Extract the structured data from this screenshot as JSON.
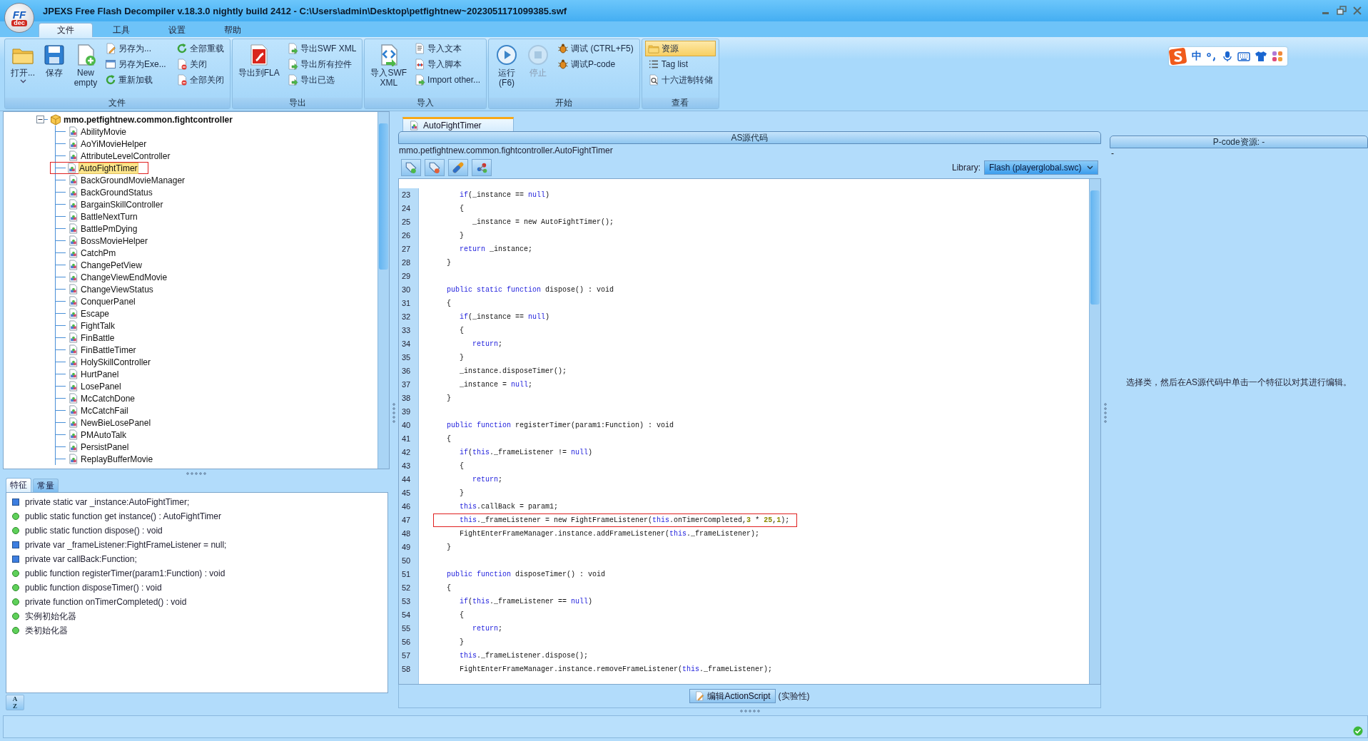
{
  "window": {
    "logo_top": "FF",
    "logo_bottom": "dec",
    "title": "JPEXS Free Flash Decompiler v.18.3.0 nightly build 2412 - C:\\Users\\admin\\Desktop\\petfightnew~2023051171099385.swf"
  },
  "menu_tabs": [
    {
      "label": "文件",
      "selected": true
    },
    {
      "label": "工具",
      "selected": false
    },
    {
      "label": "设置",
      "selected": false
    },
    {
      "label": "帮助",
      "selected": false
    }
  ],
  "ribbon": [
    {
      "title": "文件",
      "large": [
        {
          "lines": [
            "打开..."
          ],
          "dropdown": true,
          "disabled": false
        },
        {
          "lines": [
            "保存"
          ],
          "dropdown": false,
          "disabled": false
        },
        {
          "lines": [
            "New",
            "empty"
          ],
          "dropdown": false,
          "disabled": false
        }
      ],
      "small": [
        {
          "label": "另存为..."
        },
        {
          "label": "另存为Exe..."
        },
        {
          "label": "重新加载"
        },
        {
          "label": "全部重载"
        },
        {
          "label": "关闭"
        },
        {
          "label": "全部关闭"
        }
      ]
    },
    {
      "title": "导出",
      "large": [
        {
          "lines": [
            "导出到FLA"
          ],
          "dropdown": false,
          "disabled": false
        }
      ],
      "small": [
        {
          "label": "导出SWF XML"
        },
        {
          "label": "导出所有控件"
        },
        {
          "label": "导出已选"
        }
      ]
    },
    {
      "title": "导入",
      "large": [
        {
          "lines": [
            "导入SWF",
            "XML"
          ],
          "dropdown": false,
          "disabled": false
        }
      ],
      "small": [
        {
          "label": "导入文本"
        },
        {
          "label": "导入脚本"
        },
        {
          "label": "Import other..."
        }
      ]
    },
    {
      "title": "开始",
      "large": [
        {
          "lines": [
            "运行",
            "(F6)"
          ],
          "dropdown": false,
          "disabled": false
        },
        {
          "lines": [
            "停止"
          ],
          "dropdown": false,
          "disabled": true
        }
      ],
      "small": [
        {
          "label": "调试 (CTRL+F5)"
        },
        {
          "label": "调试P-code"
        }
      ]
    },
    {
      "title": "查看",
      "small": [
        {
          "label": "资源",
          "selected": true
        },
        {
          "label": "Tag list",
          "selected": false
        },
        {
          "label": "十六进制转储",
          "selected": false
        }
      ]
    }
  ],
  "ime_bar": {
    "mode": "中"
  },
  "tree": {
    "label": "mmo.petfightnew.common.fightcontroller",
    "expanded": true,
    "children": [
      {
        "label": "AbilityMovie",
        "selected": false,
        "outlined": false
      },
      {
        "label": "AoYiMovieHelper",
        "selected": false,
        "outlined": false
      },
      {
        "label": "AttributeLevelController",
        "selected": false,
        "outlined": false
      },
      {
        "label": "AutoFightTimer",
        "selected": true,
        "outlined": true
      },
      {
        "label": "BackGroundMovieManager",
        "selected": false,
        "outlined": false
      },
      {
        "label": "BackGroundStatus",
        "selected": false,
        "outlined": false
      },
      {
        "label": "BargainSkillController",
        "selected": false,
        "outlined": false
      },
      {
        "label": "BattleNextTurn",
        "selected": false,
        "outlined": false
      },
      {
        "label": "BattlePmDying",
        "selected": false,
        "outlined": false
      },
      {
        "label": "BossMovieHelper",
        "selected": false,
        "outlined": false
      },
      {
        "label": "CatchPm",
        "selected": false,
        "outlined": false
      },
      {
        "label": "ChangePetView",
        "selected": false,
        "outlined": false
      },
      {
        "label": "ChangeViewEndMovie",
        "selected": false,
        "outlined": false
      },
      {
        "label": "ChangeViewStatus",
        "selected": false,
        "outlined": false
      },
      {
        "label": "ConquerPanel",
        "selected": false,
        "outlined": false
      },
      {
        "label": "Escape",
        "selected": false,
        "outlined": false
      },
      {
        "label": "FightTalk",
        "selected": false,
        "outlined": false
      },
      {
        "label": "FinBattle",
        "selected": false,
        "outlined": false
      },
      {
        "label": "FinBattleTimer",
        "selected": false,
        "outlined": false
      },
      {
        "label": "HolySkillController",
        "selected": false,
        "outlined": false
      },
      {
        "label": "HurtPanel",
        "selected": false,
        "outlined": false
      },
      {
        "label": "LosePanel",
        "selected": false,
        "outlined": false
      },
      {
        "label": "McCatchDone",
        "selected": false,
        "outlined": false
      },
      {
        "label": "McCatchFail",
        "selected": false,
        "outlined": false
      },
      {
        "label": "NewBieLosePanel",
        "selected": false,
        "outlined": false
      },
      {
        "label": "PMAutoTalk",
        "selected": false,
        "outlined": false
      },
      {
        "label": "PersistPanel",
        "selected": false,
        "outlined": false
      },
      {
        "label": "ReplayBufferMovie",
        "selected": false,
        "outlined": false
      }
    ]
  },
  "feature_tabs": [
    {
      "label": "特征",
      "selected": true
    },
    {
      "label": "常量",
      "selected": false
    }
  ],
  "features": [
    {
      "kind": "var",
      "text": "private static var _instance:AutoFightTimer;"
    },
    {
      "kind": "method",
      "text": "public static function get instance() : AutoFightTimer"
    },
    {
      "kind": "method",
      "text": "public static function dispose() : void"
    },
    {
      "kind": "var",
      "text": "private var _frameListener:FightFrameListener = null;"
    },
    {
      "kind": "var",
      "text": "private var callBack:Function;"
    },
    {
      "kind": "method",
      "text": "public function registerTimer(param1:Function) : void"
    },
    {
      "kind": "method",
      "text": "public function disposeTimer() : void"
    },
    {
      "kind": "method",
      "text": "private function onTimerCompleted() : void"
    },
    {
      "kind": "method",
      "text": "实例初始化器"
    },
    {
      "kind": "method",
      "text": "类初始化器"
    }
  ],
  "sort_button": {
    "top": "A",
    "bottom": "Z"
  },
  "editor": {
    "tabs": [
      {
        "label": "AutoFightTimer",
        "selected": true
      }
    ],
    "header": "AS源代码",
    "path": "mmo.petfightnew.common.fightcontroller.AutoFightTimer",
    "library_label": "Library:",
    "library_value": "Flash (playerglobal.swc)",
    "lines": [
      {
        "number": "23",
        "boxed": false,
        "tokens": [
          {
            "kind": "kw",
            "text": "      if"
          },
          {
            "kind": "p",
            "text": "(_instance == "
          },
          {
            "kind": "kw",
            "text": "null"
          },
          {
            "kind": "p",
            "text": ")"
          }
        ]
      },
      {
        "number": "24",
        "boxed": false,
        "tokens": [
          {
            "kind": "p",
            "text": "      {"
          }
        ]
      },
      {
        "number": "25",
        "boxed": false,
        "tokens": [
          {
            "kind": "p",
            "text": "         _instance = new AutoFightTimer();"
          }
        ]
      },
      {
        "number": "26",
        "boxed": false,
        "tokens": [
          {
            "kind": "p",
            "text": "      }"
          }
        ]
      },
      {
        "number": "27",
        "boxed": false,
        "tokens": [
          {
            "kind": "kw",
            "text": "      return"
          },
          {
            "kind": "p",
            "text": " _instance;"
          }
        ]
      },
      {
        "number": "28",
        "boxed": false,
        "tokens": [
          {
            "kind": "p",
            "text": "   }"
          }
        ]
      },
      {
        "number": "29",
        "boxed": false
      },
      {
        "number": "30",
        "boxed": false,
        "tokens": [
          {
            "kind": "kw",
            "text": "   public static function"
          },
          {
            "kind": "p",
            "text": " dispose() : void"
          }
        ]
      },
      {
        "number": "31",
        "boxed": false,
        "tokens": [
          {
            "kind": "p",
            "text": "   {"
          }
        ]
      },
      {
        "number": "32",
        "boxed": false,
        "tokens": [
          {
            "kind": "kw",
            "text": "      if"
          },
          {
            "kind": "p",
            "text": "(_instance == "
          },
          {
            "kind": "kw",
            "text": "null"
          },
          {
            "kind": "p",
            "text": ")"
          }
        ]
      },
      {
        "number": "33",
        "boxed": false,
        "tokens": [
          {
            "kind": "p",
            "text": "      {"
          }
        ]
      },
      {
        "number": "34",
        "boxed": false,
        "tokens": [
          {
            "kind": "kw",
            "text": "         return"
          },
          {
            "kind": "p",
            "text": ";"
          }
        ]
      },
      {
        "number": "35",
        "boxed": false,
        "tokens": [
          {
            "kind": "p",
            "text": "      }"
          }
        ]
      },
      {
        "number": "36",
        "boxed": false,
        "tokens": [
          {
            "kind": "p",
            "text": "      _instance.disposeTimer();"
          }
        ]
      },
      {
        "number": "37",
        "boxed": false,
        "tokens": [
          {
            "kind": "p",
            "text": "      _instance = "
          },
          {
            "kind": "kw",
            "text": "null"
          },
          {
            "kind": "p",
            "text": ";"
          }
        ]
      },
      {
        "number": "38",
        "boxed": false,
        "tokens": [
          {
            "kind": "p",
            "text": "   }"
          }
        ]
      },
      {
        "number": "39",
        "boxed": false
      },
      {
        "number": "40",
        "boxed": false,
        "tokens": [
          {
            "kind": "kw",
            "text": "   public function"
          },
          {
            "kind": "p",
            "text": " registerTimer(param1:Function) : void"
          }
        ]
      },
      {
        "number": "41",
        "boxed": false,
        "tokens": [
          {
            "kind": "p",
            "text": "   {"
          }
        ]
      },
      {
        "number": "42",
        "boxed": false,
        "tokens": [
          {
            "kind": "kw",
            "text": "      if"
          },
          {
            "kind": "p",
            "text": "("
          },
          {
            "kind": "kw",
            "text": "this"
          },
          {
            "kind": "p",
            "text": "._frameListener != "
          },
          {
            "kind": "kw",
            "text": "null"
          },
          {
            "kind": "p",
            "text": ")"
          }
        ]
      },
      {
        "number": "43",
        "boxed": false,
        "tokens": [
          {
            "kind": "p",
            "text": "      {"
          }
        ]
      },
      {
        "number": "44",
        "boxed": false,
        "tokens": [
          {
            "kind": "kw",
            "text": "         return"
          },
          {
            "kind": "p",
            "text": ";"
          }
        ]
      },
      {
        "number": "45",
        "boxed": false,
        "tokens": [
          {
            "kind": "p",
            "text": "      }"
          }
        ]
      },
      {
        "number": "46",
        "boxed": false,
        "tokens": [
          {
            "kind": "kw",
            "text": "      this"
          },
          {
            "kind": "p",
            "text": ".callBack = param1;"
          }
        ]
      },
      {
        "number": "47",
        "boxed": true,
        "tokens": [
          {
            "kind": "kw",
            "text": "      this"
          },
          {
            "kind": "p",
            "text": "._frameListener = new FightFrameListener("
          },
          {
            "kind": "kw",
            "text": "this"
          },
          {
            "kind": "p",
            "text": ".onTimerCompleted,"
          },
          {
            "kind": "num",
            "text": "3"
          },
          {
            "kind": "p",
            "text": " * "
          },
          {
            "kind": "num",
            "text": "25"
          },
          {
            "kind": "p",
            "text": ","
          },
          {
            "kind": "num",
            "text": "1"
          },
          {
            "kind": "p",
            "text": ");"
          }
        ]
      },
      {
        "number": "48",
        "boxed": false,
        "tokens": [
          {
            "kind": "p",
            "text": "      FightEnterFrameManager.instance.addFrameListener("
          },
          {
            "kind": "kw",
            "text": "this"
          },
          {
            "kind": "p",
            "text": "._frameListener);"
          }
        ]
      },
      {
        "number": "49",
        "boxed": false,
        "tokens": [
          {
            "kind": "p",
            "text": "   }"
          }
        ]
      },
      {
        "number": "50",
        "boxed": false
      },
      {
        "number": "51",
        "boxed": false,
        "tokens": [
          {
            "kind": "kw",
            "text": "   public function"
          },
          {
            "kind": "p",
            "text": " disposeTimer() : void"
          }
        ]
      },
      {
        "number": "52",
        "boxed": false,
        "tokens": [
          {
            "kind": "p",
            "text": "   {"
          }
        ]
      },
      {
        "number": "53",
        "boxed": false,
        "tokens": [
          {
            "kind": "kw",
            "text": "      if"
          },
          {
            "kind": "p",
            "text": "("
          },
          {
            "kind": "kw",
            "text": "this"
          },
          {
            "kind": "p",
            "text": "._frameListener == "
          },
          {
            "kind": "kw",
            "text": "null"
          },
          {
            "kind": "p",
            "text": ")"
          }
        ]
      },
      {
        "number": "54",
        "boxed": false,
        "tokens": [
          {
            "kind": "p",
            "text": "      {"
          }
        ]
      },
      {
        "number": "55",
        "boxed": false,
        "tokens": [
          {
            "kind": "kw",
            "text": "         return"
          },
          {
            "kind": "p",
            "text": ";"
          }
        ]
      },
      {
        "number": "56",
        "boxed": false,
        "tokens": [
          {
            "kind": "p",
            "text": "      }"
          }
        ]
      },
      {
        "number": "57",
        "boxed": false,
        "tokens": [
          {
            "kind": "kw",
            "text": "      this"
          },
          {
            "kind": "p",
            "text": "._frameListener.dispose();"
          }
        ]
      },
      {
        "number": "58",
        "boxed": false,
        "tokens": [
          {
            "kind": "p",
            "text": "      FightEnterFrameManager.instance.removeFrameListener("
          },
          {
            "kind": "kw",
            "text": "this"
          },
          {
            "kind": "p",
            "text": "._frameListener);"
          }
        ]
      }
    ],
    "edit_button": "编辑ActionScript",
    "edit_note": "(实验性)"
  },
  "pcode": {
    "header": "P-code资源: -",
    "value": "-",
    "hint": "选择类，然后在AS源代码中单击一个特征以对其进行编辑。"
  }
}
